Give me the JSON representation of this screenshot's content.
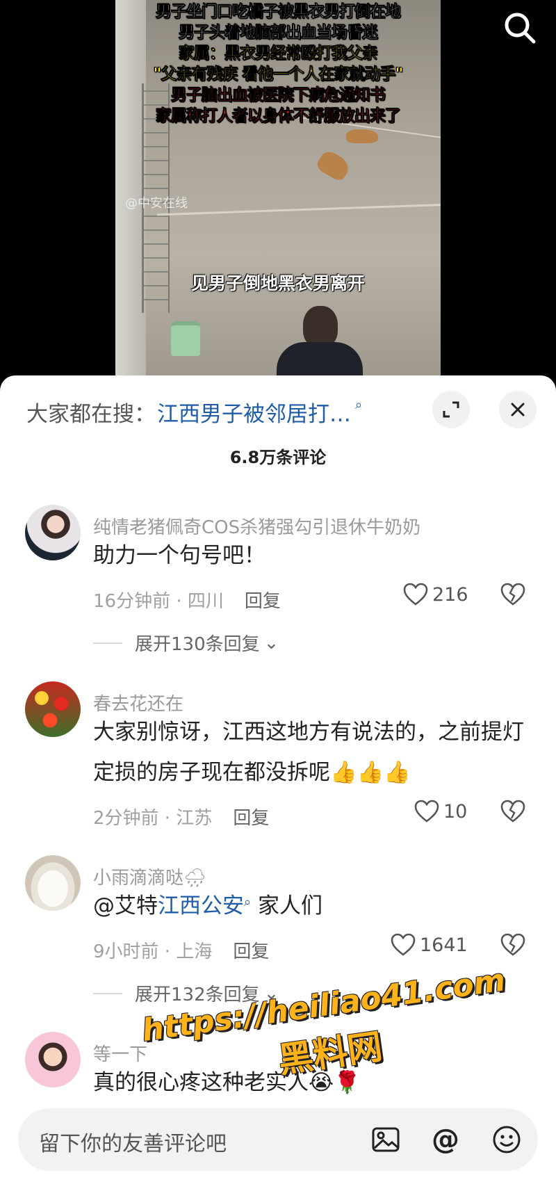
{
  "video": {
    "caption_lines": [
      "男子坐门口吃橘子被黑衣男打倒在地",
      "男子头着地脑部出血当场昏迷",
      "家属：",
      "黑衣男经常殴打我父亲",
      "\"父亲有残疾 看他一个人在家就动手\"",
      "男子脑出血被医院下病危通知书",
      "家属称打人者以身体不舒服放出来了"
    ],
    "source_watermark": "@中安在线",
    "subtitle": "见男子倒地黑衣男离开"
  },
  "panel": {
    "hot_search_prefix": "大家都在搜：",
    "hot_search_link": "江西男子被邻居打…",
    "comment_count": "6.8万条评论"
  },
  "comments": [
    {
      "username": "纯情老猪佩奇COS杀猪强勾引退休牛奶奶",
      "text": "助力一个句号吧！",
      "time": "16分钟前 · 四川",
      "reply_label": "回复",
      "likes": "216",
      "expand": "展开130条回复"
    },
    {
      "username": "春去花还在",
      "text": "大家别惊讶，江西这地方有说法的，之前提灯定损的房子现在都没拆呢👍👍👍",
      "time": "2分钟前 · 江苏",
      "reply_label": "回复",
      "likes": "10"
    },
    {
      "username": "小雨滴滴哒🌧",
      "text_prefix": "@艾特",
      "text_link": "江西公安",
      "text_suffix": " 家人们",
      "time": "9小时前 · 上海",
      "reply_label": "回复",
      "likes": "1641",
      "expand": "展开132条回复"
    },
    {
      "username": "等一下",
      "text": "真的很心疼这种老实人😭🌹"
    }
  ],
  "input": {
    "placeholder": "留下你的友善评论吧"
  },
  "overlay": {
    "url": "https://heiliao41.com",
    "name": "黑料网"
  },
  "colors": {
    "link": "#1f5da8",
    "caption_yellow": "#ffe400",
    "caption_red": "#ff2a2a",
    "watermark_orange": "#ffb21a"
  }
}
